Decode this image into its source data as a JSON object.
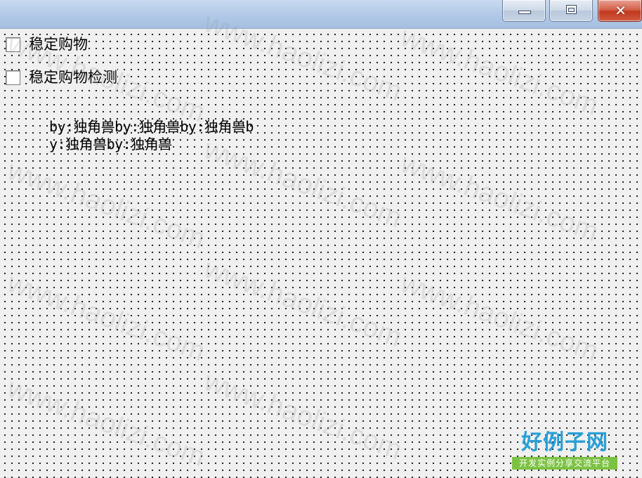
{
  "titlebar": {
    "buttons": {
      "minimize": "minimize",
      "maximize": "maximize",
      "close": "close",
      "close_glyph": "✕"
    }
  },
  "checkboxes": [
    {
      "label": "稳定购物",
      "checked": false
    },
    {
      "label": "稳定购物检测",
      "checked": false
    }
  ],
  "credit_text": "by:独角兽by:独角兽by:独角兽by:独角兽by:独角兽",
  "watermark": {
    "text": "www.haolizi.com",
    "logo_main": "好例子网",
    "logo_sub": "开发实例分享交流平台"
  },
  "colors": {
    "titlebar": "#b4cbe8",
    "client_bg": "#f0f0f0",
    "close_button": "#c2391f",
    "logo_blue": "#2a9fd6",
    "logo_green": "#7cc242"
  }
}
